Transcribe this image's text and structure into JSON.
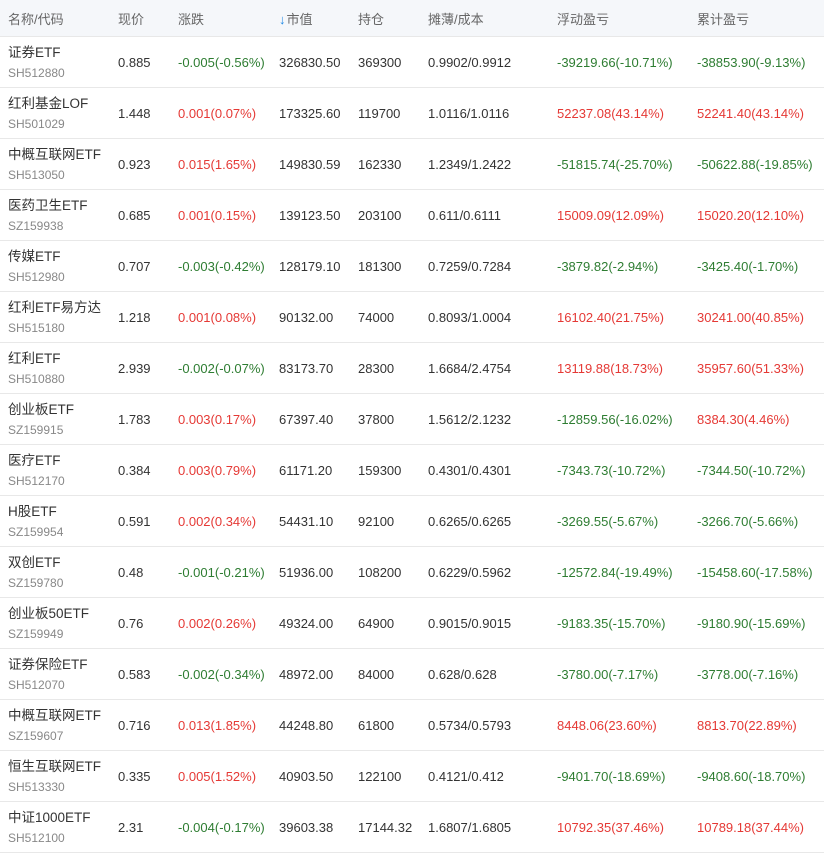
{
  "colors": {
    "up": "#e53935",
    "down": "#2e7d32",
    "sort_arrow": "#1e88e5"
  },
  "header": {
    "name": "名称/代码",
    "price": "现价",
    "change": "涨跌",
    "sort_icon": "↓",
    "market_value": "市值",
    "position": "持仓",
    "cost": "摊薄/成本",
    "float_pl": "浮动盈亏",
    "total_pl": "累计盈亏"
  },
  "rows": [
    {
      "name": "证券ETF",
      "code": "SH512880",
      "price": "0.885",
      "change": "-0.005(-0.56%)",
      "change_dir": "down",
      "mv": "326830.50",
      "pos": "369300",
      "cost": "0.9902/0.9912",
      "fpl": "-39219.66(-10.71%)",
      "fpl_dir": "down",
      "tpl": "-38853.90(-9.13%)",
      "tpl_dir": "down"
    },
    {
      "name": "红利基金LOF",
      "code": "SH501029",
      "price": "1.448",
      "change": "0.001(0.07%)",
      "change_dir": "up",
      "mv": "173325.60",
      "pos": "119700",
      "cost": "1.0116/1.0116",
      "fpl": "52237.08(43.14%)",
      "fpl_dir": "up",
      "tpl": "52241.40(43.14%)",
      "tpl_dir": "up"
    },
    {
      "name": "中概互联网ETF",
      "code": "SH513050",
      "price": "0.923",
      "change": "0.015(1.65%)",
      "change_dir": "up",
      "mv": "149830.59",
      "pos": "162330",
      "cost": "1.2349/1.2422",
      "fpl": "-51815.74(-25.70%)",
      "fpl_dir": "down",
      "tpl": "-50622.88(-19.85%)",
      "tpl_dir": "down"
    },
    {
      "name": "医药卫生ETF",
      "code": "SZ159938",
      "price": "0.685",
      "change": "0.001(0.15%)",
      "change_dir": "up",
      "mv": "139123.50",
      "pos": "203100",
      "cost": "0.611/0.6111",
      "fpl": "15009.09(12.09%)",
      "fpl_dir": "up",
      "tpl": "15020.20(12.10%)",
      "tpl_dir": "up"
    },
    {
      "name": "传媒ETF",
      "code": "SH512980",
      "price": "0.707",
      "change": "-0.003(-0.42%)",
      "change_dir": "down",
      "mv": "128179.10",
      "pos": "181300",
      "cost": "0.7259/0.7284",
      "fpl": "-3879.82(-2.94%)",
      "fpl_dir": "down",
      "tpl": "-3425.40(-1.70%)",
      "tpl_dir": "down"
    },
    {
      "name": "红利ETF易方达",
      "code": "SH515180",
      "price": "1.218",
      "change": "0.001(0.08%)",
      "change_dir": "up",
      "mv": "90132.00",
      "pos": "74000",
      "cost": "0.8093/1.0004",
      "fpl": "16102.40(21.75%)",
      "fpl_dir": "up",
      "tpl": "30241.00(40.85%)",
      "tpl_dir": "up"
    },
    {
      "name": "红利ETF",
      "code": "SH510880",
      "price": "2.939",
      "change": "-0.002(-0.07%)",
      "change_dir": "down",
      "mv": "83173.70",
      "pos": "28300",
      "cost": "1.6684/2.4754",
      "fpl": "13119.88(18.73%)",
      "fpl_dir": "up",
      "tpl": "35957.60(51.33%)",
      "tpl_dir": "up"
    },
    {
      "name": "创业板ETF",
      "code": "SZ159915",
      "price": "1.783",
      "change": "0.003(0.17%)",
      "change_dir": "up",
      "mv": "67397.40",
      "pos": "37800",
      "cost": "1.5612/2.1232",
      "fpl": "-12859.56(-16.02%)",
      "fpl_dir": "down",
      "tpl": "8384.30(4.46%)",
      "tpl_dir": "up"
    },
    {
      "name": "医疗ETF",
      "code": "SH512170",
      "price": "0.384",
      "change": "0.003(0.79%)",
      "change_dir": "up",
      "mv": "61171.20",
      "pos": "159300",
      "cost": "0.4301/0.4301",
      "fpl": "-7343.73(-10.72%)",
      "fpl_dir": "down",
      "tpl": "-7344.50(-10.72%)",
      "tpl_dir": "down"
    },
    {
      "name": "H股ETF",
      "code": "SZ159954",
      "price": "0.591",
      "change": "0.002(0.34%)",
      "change_dir": "up",
      "mv": "54431.10",
      "pos": "92100",
      "cost": "0.6265/0.6265",
      "fpl": "-3269.55(-5.67%)",
      "fpl_dir": "down",
      "tpl": "-3266.70(-5.66%)",
      "tpl_dir": "down"
    },
    {
      "name": "双创ETF",
      "code": "SZ159780",
      "price": "0.48",
      "change": "-0.001(-0.21%)",
      "change_dir": "down",
      "mv": "51936.00",
      "pos": "108200",
      "cost": "0.6229/0.5962",
      "fpl": "-12572.84(-19.49%)",
      "fpl_dir": "down",
      "tpl": "-15458.60(-17.58%)",
      "tpl_dir": "down"
    },
    {
      "name": "创业板50ETF",
      "code": "SZ159949",
      "price": "0.76",
      "change": "0.002(0.26%)",
      "change_dir": "up",
      "mv": "49324.00",
      "pos": "64900",
      "cost": "0.9015/0.9015",
      "fpl": "-9183.35(-15.70%)",
      "fpl_dir": "down",
      "tpl": "-9180.90(-15.69%)",
      "tpl_dir": "down"
    },
    {
      "name": "证券保险ETF",
      "code": "SH512070",
      "price": "0.583",
      "change": "-0.002(-0.34%)",
      "change_dir": "down",
      "mv": "48972.00",
      "pos": "84000",
      "cost": "0.628/0.628",
      "fpl": "-3780.00(-7.17%)",
      "fpl_dir": "down",
      "tpl": "-3778.00(-7.16%)",
      "tpl_dir": "down"
    },
    {
      "name": "中概互联网ETF",
      "code": "SZ159607",
      "price": "0.716",
      "change": "0.013(1.85%)",
      "change_dir": "up",
      "mv": "44248.80",
      "pos": "61800",
      "cost": "0.5734/0.5793",
      "fpl": "8448.06(23.60%)",
      "fpl_dir": "up",
      "tpl": "8813.70(22.89%)",
      "tpl_dir": "up"
    },
    {
      "name": "恒生互联网ETF",
      "code": "SH513330",
      "price": "0.335",
      "change": "0.005(1.52%)",
      "change_dir": "up",
      "mv": "40903.50",
      "pos": "122100",
      "cost": "0.4121/0.412",
      "fpl": "-9401.70(-18.69%)",
      "fpl_dir": "down",
      "tpl": "-9408.60(-18.70%)",
      "tpl_dir": "down"
    },
    {
      "name": "中证1000ETF",
      "code": "SH512100",
      "price": "2.31",
      "change": "-0.004(-0.17%)",
      "change_dir": "down",
      "mv": "39603.38",
      "pos": "17144.32",
      "cost": "1.6807/1.6805",
      "fpl": "10792.35(37.46%)",
      "fpl_dir": "up",
      "tpl": "10789.18(37.44%)",
      "tpl_dir": "up"
    }
  ]
}
